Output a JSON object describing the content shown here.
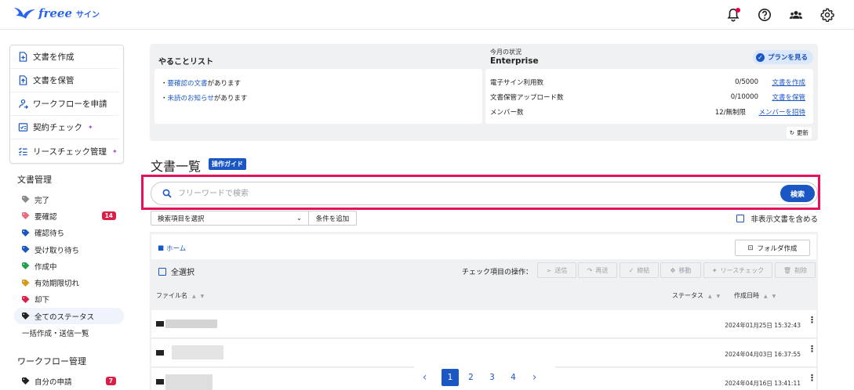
{
  "app": {
    "brand": "freee",
    "product": "サイン"
  },
  "header_icons": [
    "bell-icon",
    "help-icon",
    "team-icon",
    "gear-icon"
  ],
  "sidebar": {
    "actions": [
      {
        "label": "文書を作成",
        "icon": "doc-plus-icon"
      },
      {
        "label": "文書を保管",
        "icon": "doc-store-icon"
      },
      {
        "label": "ワークフローを申請",
        "icon": "workflow-icon"
      },
      {
        "label": "契約チェック",
        "icon": "contract-check-icon",
        "sparkle": "✦"
      },
      {
        "label": "リースチェック管理",
        "icon": "lease-check-icon",
        "sparkle": "✦"
      }
    ],
    "doc_section_title": "文書管理",
    "statuses": [
      {
        "label": "完了",
        "color": "#8a8a8a"
      },
      {
        "label": "要確認",
        "color": "#e96a78",
        "badge": "14"
      },
      {
        "label": "確認待ち",
        "color": "#1a56c4"
      },
      {
        "label": "受け取り待ち",
        "color": "#1a56c4"
      },
      {
        "label": "作成中",
        "color": "#1fa04a"
      },
      {
        "label": "有効期限切れ",
        "color": "#d29a18"
      },
      {
        "label": "却下",
        "color": "#dc1e46"
      },
      {
        "label": "全てのステータス",
        "color": "#222222"
      }
    ],
    "bulk_link": "一括作成・送信一覧",
    "workflow_section_title": "ワークフロー管理",
    "workflow_items": [
      {
        "label": "自分の申請",
        "color": "#222222",
        "badge": "7"
      }
    ]
  },
  "todo": {
    "title": "やることリスト",
    "items": [
      {
        "prefix": "・",
        "link": "要確認の文書",
        "suffix": "があります"
      },
      {
        "prefix": "・",
        "link": "未読のお知らせ",
        "suffix": "があります"
      }
    ]
  },
  "status": {
    "label": "今月の状況",
    "plan": "Enterprise",
    "plan_button": "プランを見る",
    "rows": [
      {
        "label": "電子サイン利用数",
        "value": "0/5000",
        "link": "文書を作成"
      },
      {
        "label": "文書保管アップロード数",
        "value": "0/10000",
        "link": "文書を保管"
      },
      {
        "label": "メンバー数",
        "value": "12/無制限",
        "link": "メンバーを招待"
      }
    ],
    "refresh": "更新"
  },
  "doclist": {
    "title": "文書一覧",
    "guide": "操作ガイド",
    "search": {
      "placeholder": "フリーワードで検索",
      "value": "",
      "button": "検索"
    },
    "filter_select": "検索項目を選択",
    "filter_add": "条件を追加",
    "include_hidden": "非表示文書を含める",
    "breadcrumb_home": "ホーム",
    "make_folder": "フォルダ作成",
    "select_all": "全選択",
    "bulk_label": "チェック項目の操作：",
    "bulk_actions": [
      "送信",
      "再送",
      "締結",
      "移動",
      "リースチェック",
      "削除"
    ],
    "columns": {
      "name": "ファイル名",
      "status": "ステータス",
      "created": "作成日時"
    },
    "rows": [
      {
        "date": "2024年01月25日 15:32:43"
      },
      {
        "date": "2024年04月03日 16:37:55"
      },
      {
        "date": "2024年04月16日 13:41:11"
      }
    ]
  },
  "pagination": {
    "pages": [
      "1",
      "2",
      "3",
      "4"
    ],
    "current": "1"
  }
}
